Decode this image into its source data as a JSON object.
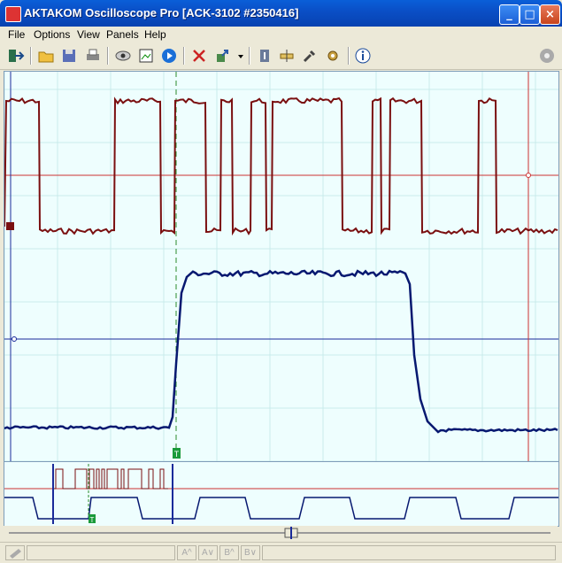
{
  "window": {
    "title": "AKTAKOM Oscilloscope Pro [ACK-3102 #2350416]"
  },
  "title_buttons": {
    "minimize": "_",
    "maximize": "□",
    "close": "×"
  },
  "menu": [
    {
      "label": "File"
    },
    {
      "label": "Options"
    },
    {
      "label": "View"
    },
    {
      "label": "Panels"
    },
    {
      "label": "Help"
    }
  ],
  "toolbar": {
    "icons": [
      "exit-icon",
      "open-folder-icon",
      "save-icon",
      "print-icon",
      "eye-icon",
      "snapshot-icon",
      "play-icon",
      "cut-icon",
      "export-icon",
      "dropdown-arrow-icon",
      "info-book-icon",
      "ruler-icon",
      "tools-icon",
      "settings-icon",
      "about-icon",
      "link-icon"
    ]
  },
  "scope": {
    "trigger_label": "T",
    "channel1_color": "#7a0f10",
    "channel2_color": "#061870",
    "grid_color": "#c9ecec",
    "cursor_color": "#cc2222"
  },
  "overview": {
    "trigger_label": "T"
  },
  "status": {
    "cells": [
      "A^",
      "A∨",
      "B^",
      "B∨"
    ]
  }
}
